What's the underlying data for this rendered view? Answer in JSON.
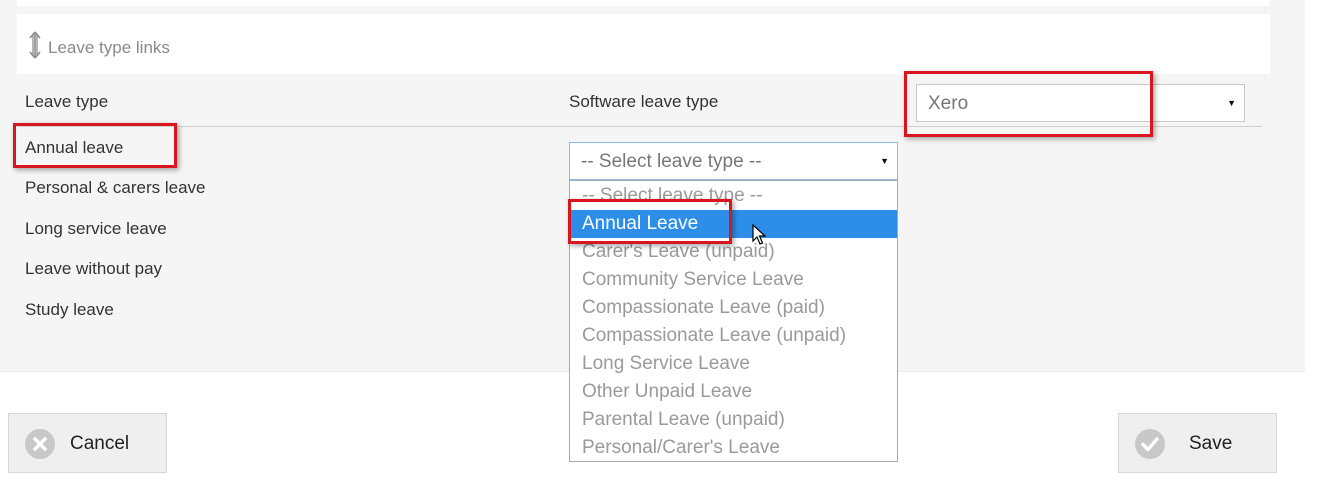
{
  "section": {
    "title": "Leave type links"
  },
  "columns": {
    "leave_type": "Leave type",
    "software_leave_type": "Software leave type"
  },
  "software_select": {
    "value": "Xero"
  },
  "leave_types": [
    "Annual leave",
    "Personal & carers leave",
    "Long service leave",
    "Leave without pay",
    "Study leave"
  ],
  "leave_select": {
    "value": "-- Select leave type --",
    "options": [
      "-- Select leave type --",
      "Annual Leave",
      "Carer's Leave (unpaid)",
      "Community Service Leave",
      "Compassionate Leave (paid)",
      "Compassionate Leave (unpaid)",
      "Long Service Leave",
      "Other Unpaid Leave",
      "Parental Leave (unpaid)",
      "Personal/Carer's Leave"
    ],
    "highlighted": "Annual Leave"
  },
  "buttons": {
    "cancel": "Cancel",
    "save": "Save"
  },
  "colors": {
    "highlight": "#2d8ee9",
    "annotation": "#d9161f"
  },
  "icons": {
    "section": "vertical-resize-icon",
    "cancel": "cancel-circle-icon",
    "save": "check-circle-icon",
    "dropdown": "caret-down-icon",
    "cursor": "mouse-pointer-icon"
  }
}
